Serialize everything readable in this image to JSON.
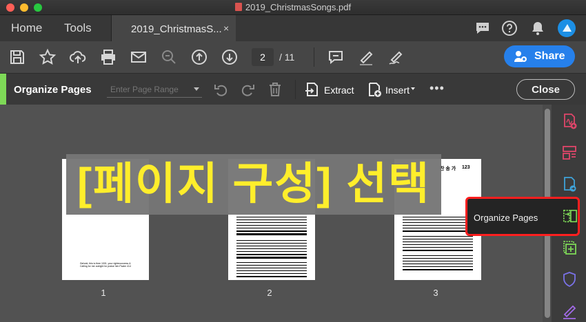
{
  "window": {
    "title": "2019_ChristmasSongs.pdf"
  },
  "nav": {
    "home": "Home",
    "tools": "Tools",
    "doc_tab": "2019_ChristmasS...",
    "doc_tab_close": "×"
  },
  "toolbar": {
    "page_current": "2",
    "page_total": "/ 11",
    "share": "Share"
  },
  "organize": {
    "title": "Organize Pages",
    "range_placeholder": "Enter Page Range",
    "extract": "Extract",
    "insert": "Insert",
    "more": "•••",
    "close": "Close"
  },
  "pages": [
    {
      "label": "1",
      "text": "Behold, this is thee 1001, your righteousness & Calling for me outright for praise him Psalm 414"
    },
    {
      "label": "2"
    },
    {
      "label": "3",
      "heading": "찬 송 가",
      "number": "123"
    }
  ],
  "overlay": {
    "text": "[페이지 구성] 선택"
  },
  "tooltip": {
    "text": "Organize Pages"
  },
  "colors": {
    "accent_green": "#7ed957",
    "share_blue": "#2680eb",
    "overlay_text": "#ffee2b",
    "highlight_red": "#ff1f1f"
  }
}
